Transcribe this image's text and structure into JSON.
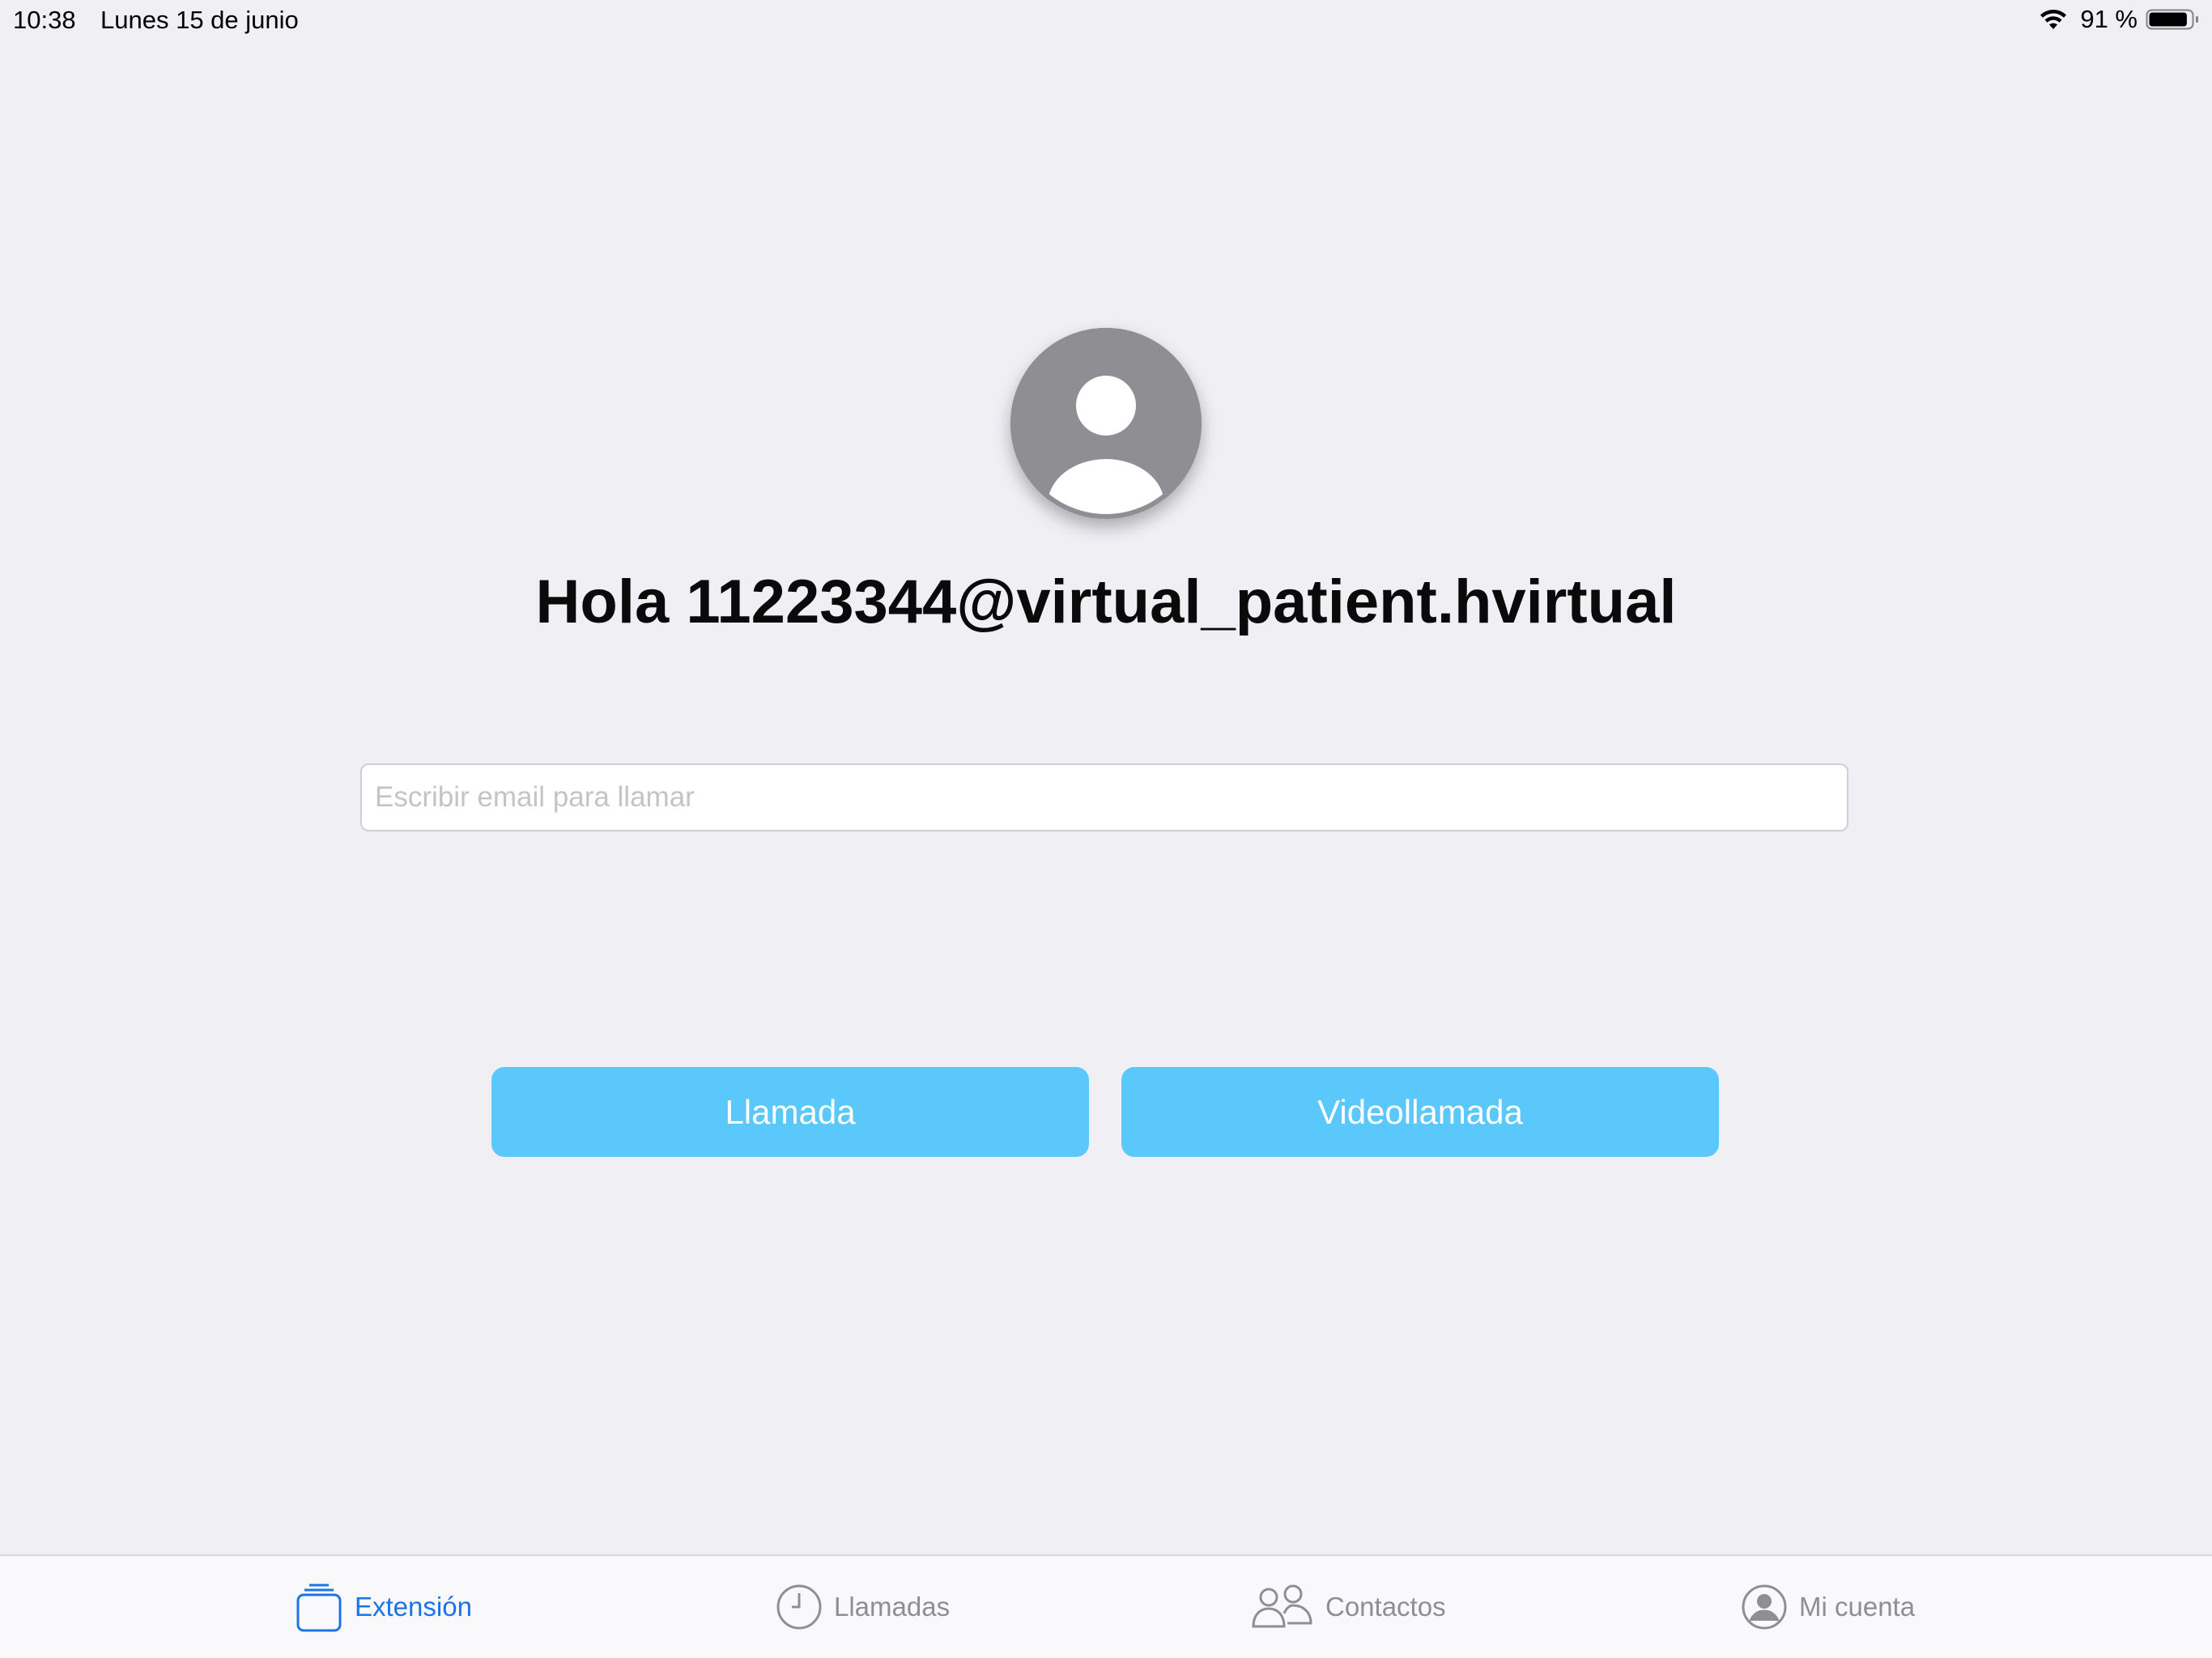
{
  "status_bar": {
    "time": "10:38",
    "date": "Lunes 15 de junio",
    "battery_percent": "91 %",
    "battery_level": 0.91,
    "icons": [
      "wifi-icon",
      "battery-icon"
    ]
  },
  "main": {
    "avatar_icon": "person-circle-icon",
    "greeting": "Hola 11223344@virtual_patient.hvirtual",
    "email_input": {
      "placeholder": "Escribir email para llamar",
      "value": ""
    },
    "call_button_label": "Llamada",
    "video_call_button_label": "Videollamada",
    "button_color": "#5ac8fa"
  },
  "tab_bar": {
    "active_color": "#1a73e8",
    "inactive_color": "#8e8e93",
    "tabs": [
      {
        "label": "Extensión",
        "icon": "extension-stack-icon",
        "active": true
      },
      {
        "label": "Llamadas",
        "icon": "clock-icon",
        "active": false
      },
      {
        "label": "Contactos",
        "icon": "contacts-icon",
        "active": false
      },
      {
        "label": "Mi cuenta",
        "icon": "account-icon",
        "active": false
      }
    ]
  }
}
